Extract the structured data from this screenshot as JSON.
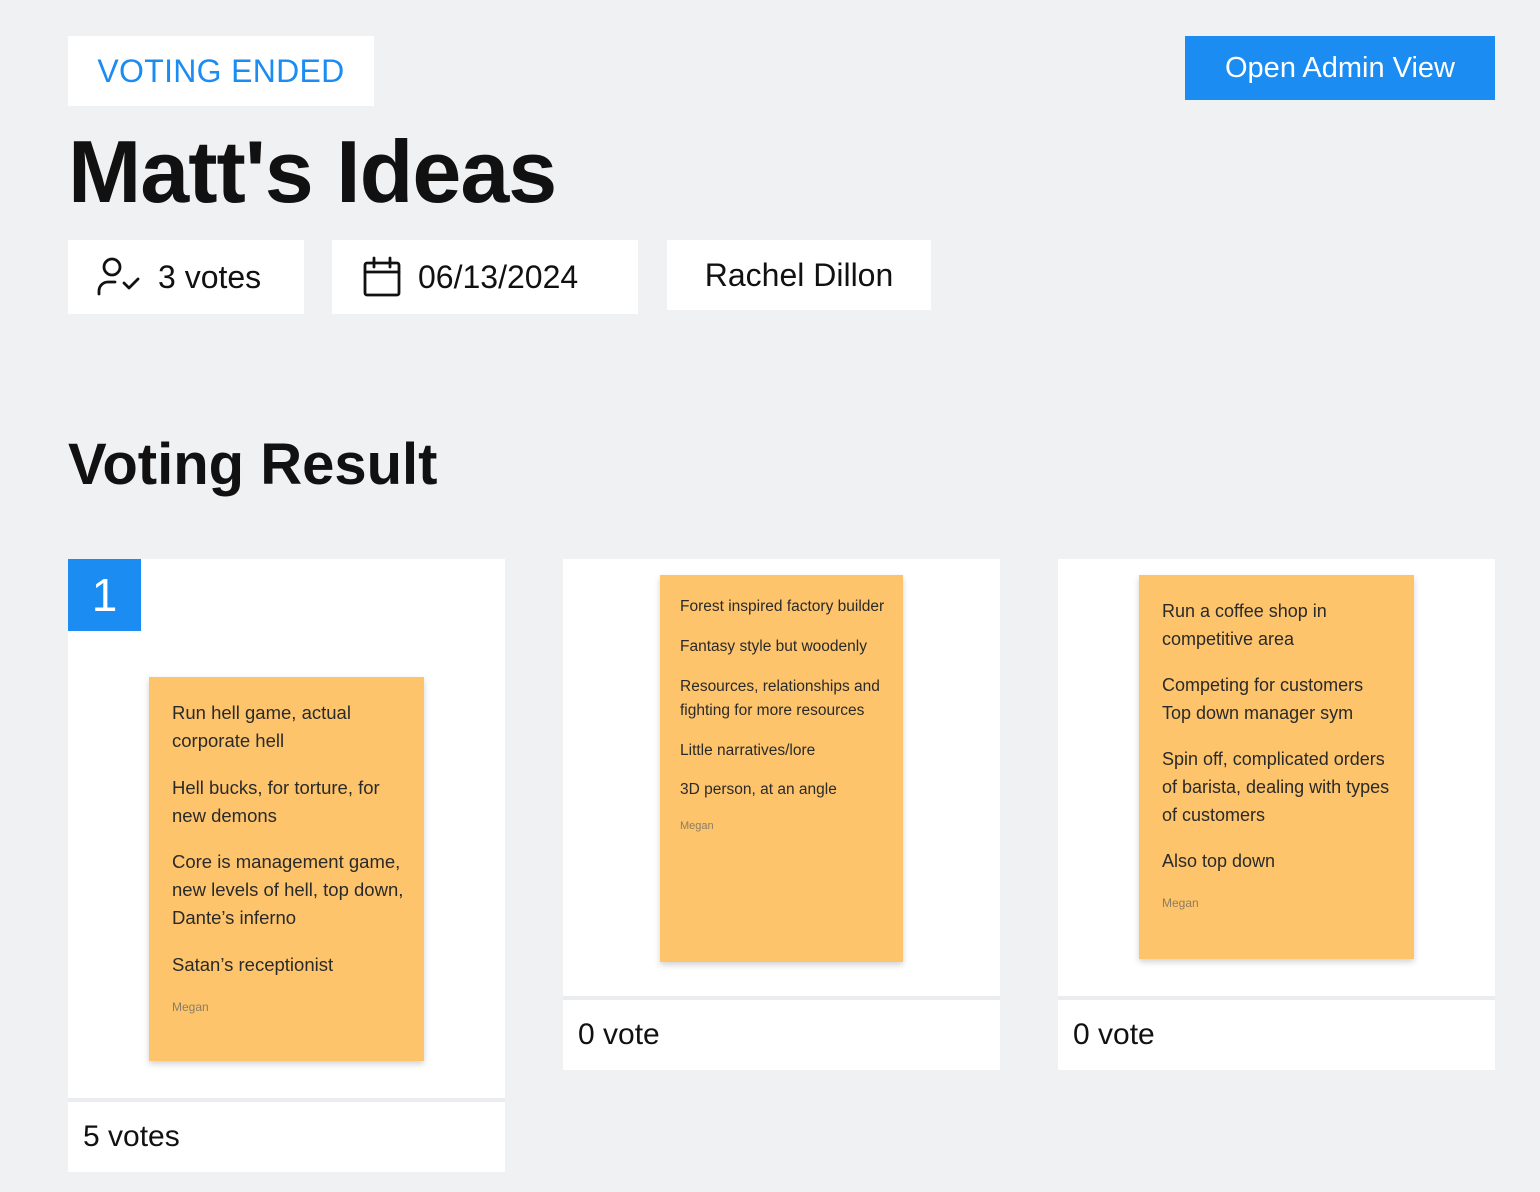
{
  "header": {
    "status": "VOTING ENDED",
    "admin_button": "Open Admin View",
    "title": "Matt's Ideas"
  },
  "meta": {
    "votes": "3 votes",
    "date": "06/13/2024",
    "owner": "Rachel Dillon",
    "votes_icon": "user-check-icon",
    "date_icon": "calendar-icon"
  },
  "section_title": "Voting Result",
  "colors": {
    "accent": "#1b8cf2",
    "sticky": "#fdc46b",
    "background": "#f0f1f3"
  },
  "results": [
    {
      "rank": "1",
      "votes": "5 votes",
      "note": [
        "Run hell game, actual corporate hell",
        "Hell bucks, for torture, for new demons",
        "Core is management game, new levels of hell, top down, Dante’s inferno",
        "Satan’s receptionist"
      ],
      "author": "Megan"
    },
    {
      "votes": "0 vote",
      "note": [
        "Forest inspired factory builder",
        "Fantasy style but woodenly",
        "Resources, relationships and fighting for more resources",
        "Little narratives/lore",
        "3D person, at an angle"
      ],
      "author": "Megan"
    },
    {
      "votes": "0 vote",
      "note": [
        "Run a coffee shop in competitive area",
        "Competing for customers\nTop down manager sym",
        "Spin off, complicated orders of barista, dealing with types of customers",
        "Also top down"
      ],
      "author": "Megan"
    }
  ]
}
